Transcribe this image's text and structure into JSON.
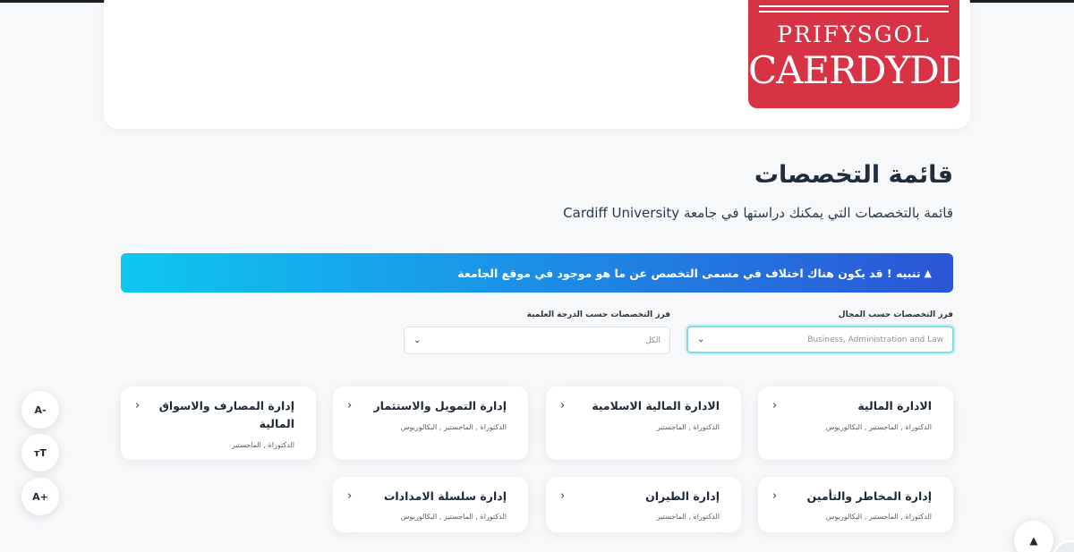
{
  "logo": {
    "line1": "PRIFYSGOL",
    "line2": "CAERDYDD"
  },
  "page": {
    "title": "قائمة التخصصات",
    "subtitle": "قائمة بالتخصصات التي يمكنك دراستها في جامعة Cardiff University"
  },
  "alert": {
    "icon": "warning-triangle-icon",
    "text": "تنبيه ! قد يكون هناك اختلاف في مسمى التخصص عن ما هو موجود في موقع الجامعة"
  },
  "filters": {
    "field": {
      "label": "فرز التخصصات حسب المجال",
      "value": "Business, Administration and Law"
    },
    "degree": {
      "label": "فرز التخصصات حسب الدرجة العلمية",
      "value": "الكل"
    }
  },
  "specialties": [
    {
      "name": "الادارة المالية",
      "degrees": "الدكتوراة , الماجستير , البكالوريوس"
    },
    {
      "name": "الادارة المالية الاسلامية",
      "degrees": "الدكتوراة , الماجستير"
    },
    {
      "name": "إدارة التمويل والاستثمار",
      "degrees": "الدكتوراة , الماجستير , البكالوريوس"
    },
    {
      "name": "إدارة المصارف والاسواق المالية",
      "degrees": "الدكتوراة , الماجستير"
    },
    {
      "name": "إدارة المخاطر والتأمين",
      "degrees": "الدكتوراة , الماجستير , البكالوريوس"
    },
    {
      "name": "إدارة الطيران",
      "degrees": "الدكتوراة , الماجستير"
    },
    {
      "name": "إدارة سلسلة الامدادات",
      "degrees": "الدكتوراة , الماجستير , البكالوريوس"
    }
  ],
  "accessibility": {
    "decrease": "A-",
    "reset": "ᴛT",
    "increase": "A+"
  },
  "icons": {
    "card_chevron": "chevron-left-icon",
    "select_chevron": "chevron-down-icon",
    "scroll_top": "arrow-up-icon"
  }
}
